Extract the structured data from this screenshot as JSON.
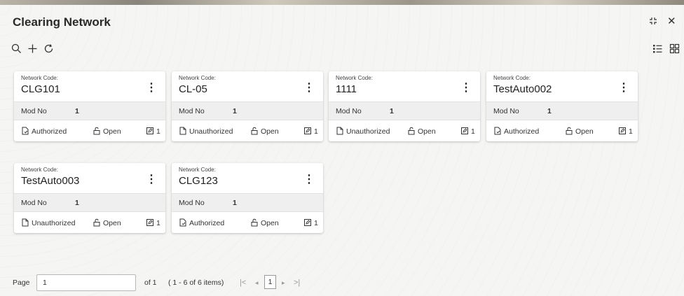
{
  "window": {
    "title": "Clearing Network",
    "restore_icon": "collapse-icon",
    "close_icon": "close-icon"
  },
  "toolbar": {
    "search_icon": "search-icon",
    "add_icon": "plus-icon",
    "refresh_icon": "refresh-icon",
    "list_view_icon": "list-view-icon",
    "grid_view_icon": "grid-view-icon"
  },
  "cards": [
    {
      "label": "Network Code:",
      "code": "CLG101",
      "mod_label": "Mod No",
      "mod_value": "1",
      "status": "Authorized",
      "lock": "Open",
      "version": "1"
    },
    {
      "label": "Network Code:",
      "code": "CL-05",
      "mod_label": "Mod No",
      "mod_value": "1",
      "status": "Unauthorized",
      "lock": "Open",
      "version": "1"
    },
    {
      "label": "Network Code:",
      "code": "1111",
      "mod_label": "Mod No",
      "mod_value": "1",
      "status": "Unauthorized",
      "lock": "Open",
      "version": "1"
    },
    {
      "label": "Network Code:",
      "code": "TestAuto002",
      "mod_label": "Mod No",
      "mod_value": "1",
      "status": "Authorized",
      "lock": "Open",
      "version": "1"
    },
    {
      "label": "Network Code:",
      "code": "TestAuto003",
      "mod_label": "Mod No",
      "mod_value": "1",
      "status": "Unauthorized",
      "lock": "Open",
      "version": "1"
    },
    {
      "label": "Network Code:",
      "code": "CLG123",
      "mod_label": "Mod No",
      "mod_value": "1",
      "status": "Authorized",
      "lock": "Open",
      "version": "1"
    }
  ],
  "pager": {
    "page_label": "Page",
    "page_value": "1",
    "of_label": "of 1",
    "items_label": "( 1 - 6 of 6 items)",
    "current_page": "1"
  }
}
